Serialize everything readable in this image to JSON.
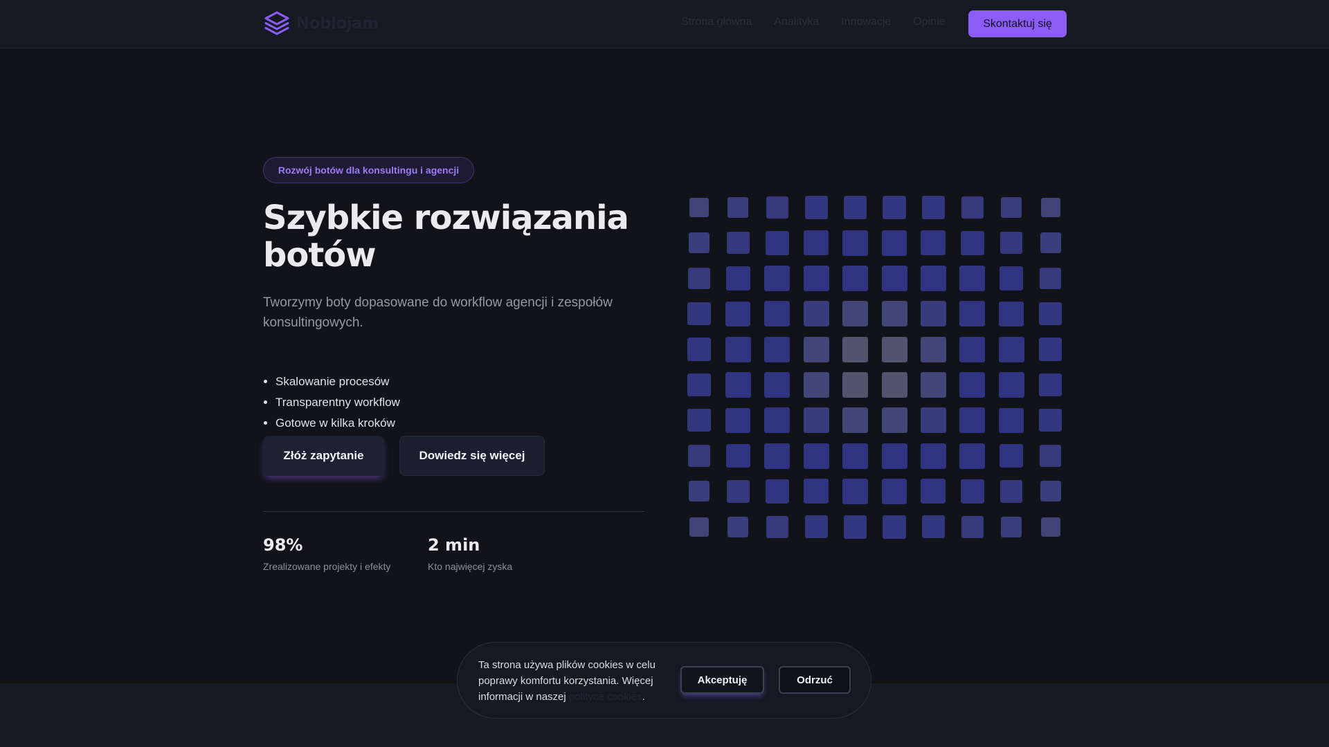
{
  "header": {
    "brand": "Noblojam",
    "logo_icon": "layers-icon",
    "nav": [
      "Strona główna",
      "Analityka",
      "Innowacje",
      "Opinie"
    ],
    "cta": "Skontaktuj się"
  },
  "hero": {
    "badge": "Rozwój botów dla konsultingu i agencji",
    "title": "Szybkie rozwiązania botów",
    "subtitle": "Tworzymy boty dopasowane do workflow agencji i zespołów konsultingowych.",
    "features": [
      "Skalowanie procesów",
      "Transparentny workflow",
      "Gotowe w kilka kroków"
    ],
    "primary_button": "Złóż zapytanie",
    "secondary_button": "Dowiedz się więcej"
  },
  "stats": [
    {
      "value": "98%",
      "label": "Zrealizowane projekty i efekty"
    },
    {
      "value": "2 min",
      "label": "Kto najwięcej zyska"
    }
  ],
  "cookie": {
    "text_before": "Ta strona używa plików cookies w celu poprawy komfortu korzystania. Więcej informacji w naszej",
    "link": "polityce cookies",
    "text_after": ".",
    "accept": "Akceptuję",
    "reject": "Odrzuć"
  },
  "colors": {
    "background": "#111318",
    "accent": "#8b5cf6",
    "grid_blue": "#2f3380",
    "grid_gray": "#5f6169"
  }
}
